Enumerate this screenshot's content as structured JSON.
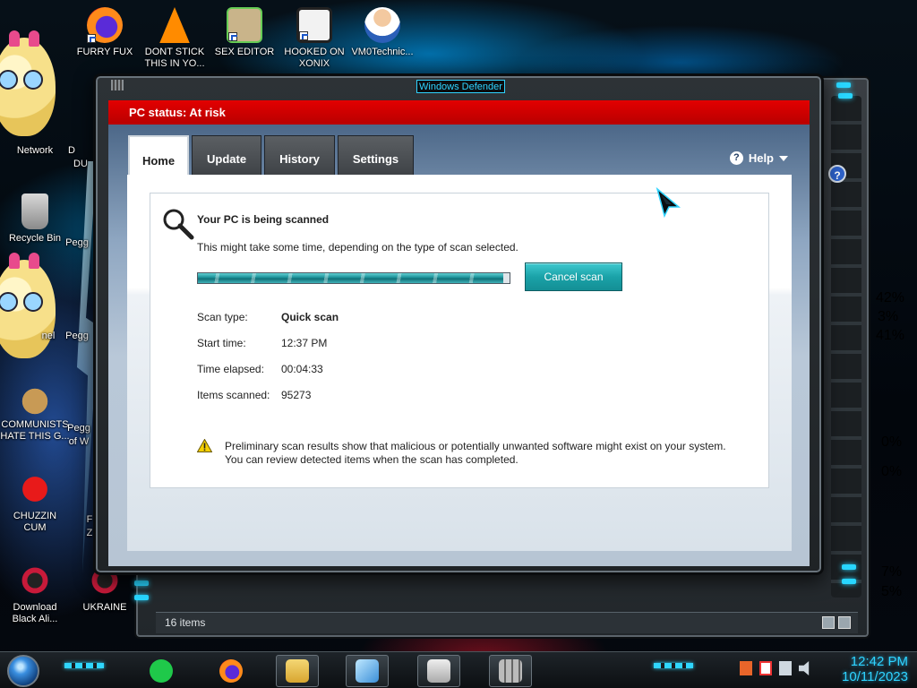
{
  "desktop": {
    "icons": [
      {
        "label": "FURRY FUX",
        "icon": "firefox-icon"
      },
      {
        "label": "DONT STICK\nTHIS IN YO...",
        "icon": "vlc-icon"
      },
      {
        "label": "SEX EDITOR",
        "icon": "hxd-icon"
      },
      {
        "label": "HOOKED ON\nXONIX",
        "icon": "maze-game-icon"
      },
      {
        "label": "VM0Technic...",
        "icon": "doctor-icon"
      },
      {
        "label": "Network",
        "icon": "network-icon"
      },
      {
        "label": "Recycle Bin",
        "icon": "recycle-bin-icon"
      },
      {
        "label": "COMMUNISTS\nHATE THIS G...",
        "icon": "money-bag-icon"
      },
      {
        "label": "CHUZZIN\nCUM",
        "icon": "fuzzball-icon"
      },
      {
        "label": "Download\nBlack Ali...",
        "icon": "alien-icon"
      },
      {
        "label": "UKRAINE",
        "icon": "ukraine-icon"
      }
    ],
    "partial_labels": [
      "D",
      "DU",
      "Pegg",
      "nel",
      "Pegg",
      "Pegg",
      "of W",
      "F",
      "Z"
    ]
  },
  "explorer": {
    "status_text": "16 items"
  },
  "defender": {
    "window_title": "Windows Defender",
    "pc_status": "PC status: At risk",
    "tabs": [
      {
        "label": "Home",
        "active": true
      },
      {
        "label": "Update",
        "active": false
      },
      {
        "label": "History",
        "active": false
      },
      {
        "label": "Settings",
        "active": false
      }
    ],
    "help_label": "Help",
    "scan": {
      "heading": "Your PC is being scanned",
      "description": "This might take some time, depending on the type of scan selected.",
      "progress_percent": 98,
      "cancel_label": "Cancel scan",
      "details": [
        {
          "key": "Scan type:",
          "value": "Quick scan",
          "bold": true
        },
        {
          "key": "Start time:",
          "value": "12:37 PM",
          "bold": false
        },
        {
          "key": "Time elapsed:",
          "value": "00:04:33",
          "bold": false
        },
        {
          "key": "Items scanned:",
          "value": "95273",
          "bold": false
        }
      ],
      "warning_line1": "Preliminary scan results show that malicious or potentially unwanted software might exist on your system.",
      "warning_line2": "You can review detected items when the scan has completed."
    },
    "colors": {
      "status_red": "#d40000",
      "accent_teal": "#1aa2a8"
    }
  },
  "taskbar": {
    "pinned": [
      "start-orb",
      "notes-icon",
      "firefox-icon",
      "file-explorer-icon",
      "pen-icon",
      "printer-icon",
      "defender-icon"
    ],
    "clock_time": "12:42 PM",
    "clock_date": "10/11/2023"
  },
  "rail_readouts": [
    "42%",
    "3%",
    "41%",
    "0%",
    "0%",
    "7%",
    "5%"
  ]
}
